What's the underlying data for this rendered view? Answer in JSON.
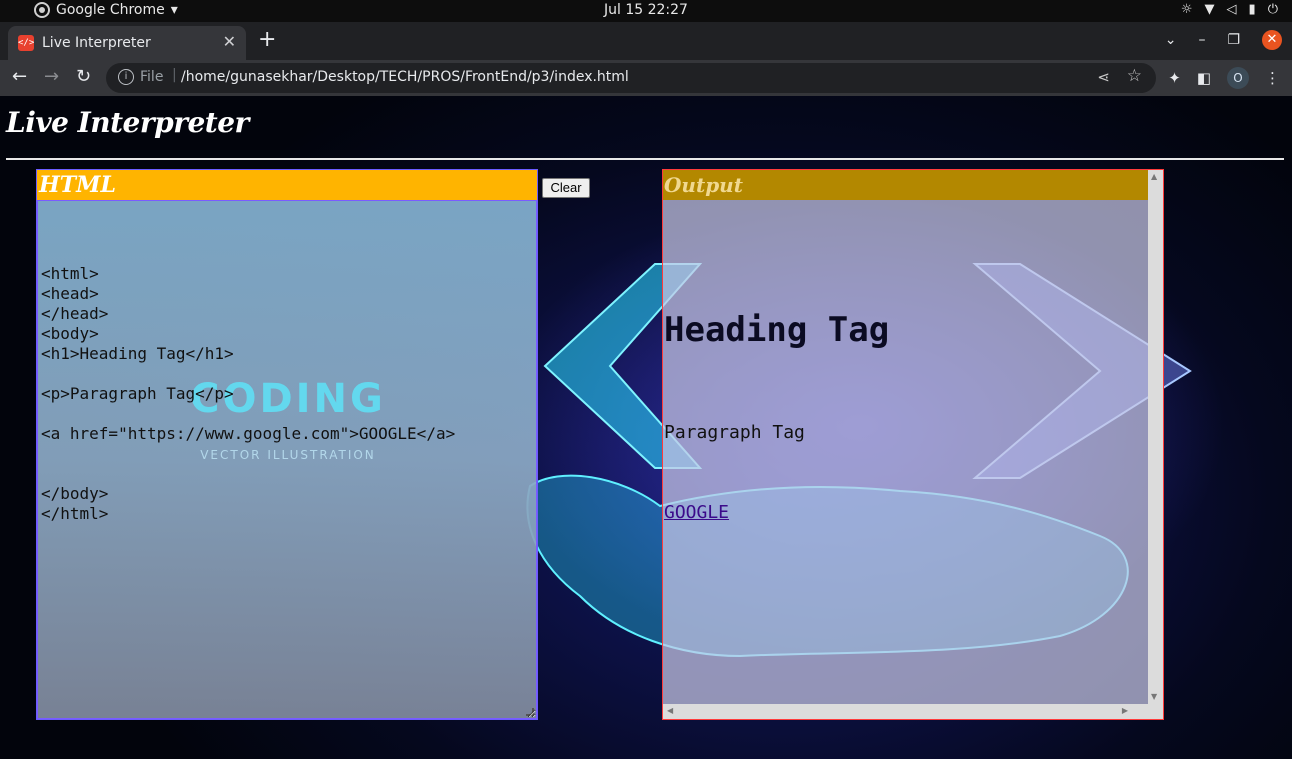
{
  "system_bar": {
    "app_name": "Google Chrome",
    "app_caret": "▾",
    "datetime": "Jul 15  22:27"
  },
  "browser": {
    "tab": {
      "favicon": "</>",
      "title": "Live Interpreter",
      "close": "✕"
    },
    "new_tab": "+",
    "scheme": "File",
    "separator": "|",
    "url": "/home/gunasekhar/Desktop/TECH/PROS/FrontEnd/p3/index.html",
    "profile_initial": "O",
    "window_controls": {
      "dropdown": "⌄",
      "minimize": "–",
      "restore": "❐",
      "close": "✕"
    },
    "nav": {
      "back": "←",
      "forward": "→",
      "reload": "↻"
    }
  },
  "page": {
    "title": "Live Interpreter",
    "editor": {
      "header": "HTML",
      "code": "<html>\n<head>\n</head>\n<body>\n<h1>Heading Tag</h1>\n\n<p>Paragraph Tag</p>\n\n<a href=\"https://www.google.com\">GOOGLE</a>\n\n\n</body>\n</html>",
      "watermark_big": "CODING",
      "watermark_small": "VECTOR ILLUSTRATION"
    },
    "clear_button": "Clear",
    "output": {
      "header": "Output",
      "heading": "Heading Tag",
      "paragraph": "Paragraph Tag",
      "link": "GOOGLE"
    }
  },
  "colors": {
    "editor_header": "#ffb400",
    "output_header": "#b38800",
    "editor_border": "#6b5cff",
    "output_border": "#ff3b3b",
    "link": "#3b0a8a"
  },
  "icons": {
    "tray": [
      "brightness-icon",
      "wifi-icon",
      "volume-muted-icon",
      "battery-icon",
      "power-icon"
    ],
    "toolbar_right": [
      "extensions-icon",
      "side-panel-icon",
      "profile-avatar",
      "menu-icon"
    ],
    "omnibox": [
      "site-info-icon",
      "share-icon",
      "bookmark-star-icon"
    ]
  }
}
